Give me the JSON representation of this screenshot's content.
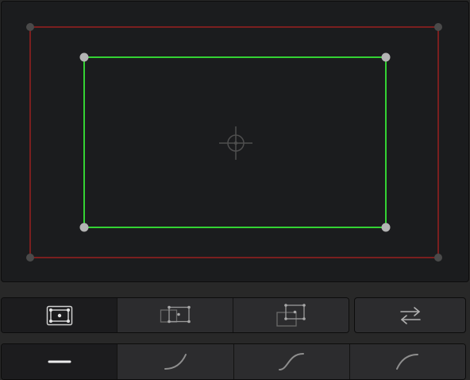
{
  "viewer": {
    "colors": {
      "background": "#1b1c1e",
      "outer_frame": "#7a1f1f",
      "outer_handle": "#4a4a4a",
      "inner_frame": "#33d233",
      "inner_handle": "#b4b4b4",
      "crosshair": "#4e4e4e"
    }
  },
  "transform_mode_toolbar": {
    "buttons": [
      {
        "icon": "transform-box-icon",
        "active": true
      },
      {
        "icon": "move-inner-box-icon",
        "active": false
      },
      {
        "icon": "move-outer-box-icon",
        "active": false
      }
    ]
  },
  "swap_button": {
    "icon": "swap-arrows-icon"
  },
  "easing_toolbar": {
    "buttons": [
      {
        "icon": "linear-ease-icon",
        "active": true
      },
      {
        "icon": "ease-in-icon",
        "active": false
      },
      {
        "icon": "ease-in-out-icon",
        "active": false
      },
      {
        "icon": "ease-out-icon",
        "active": false
      }
    ]
  }
}
